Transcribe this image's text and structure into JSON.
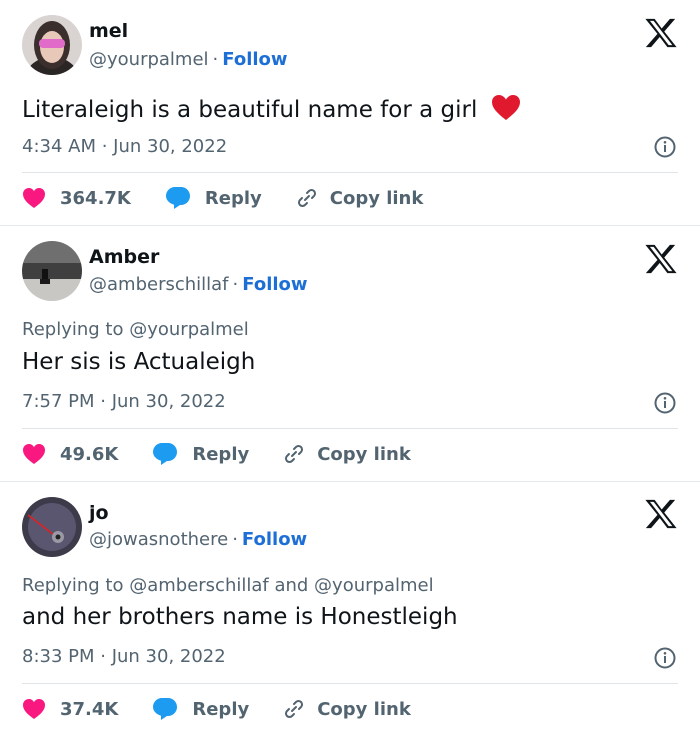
{
  "tweets": [
    {
      "name": "mel",
      "handle": "@yourpalmel",
      "follow": "Follow",
      "replying_prefix": "",
      "replying_to": "",
      "text": "Literaleigh is a beautiful name for a girl",
      "time": "4:34 AM · Jun 30, 2022",
      "likes": "364.7K",
      "reply_label": "Reply",
      "copy_label": "Copy link"
    },
    {
      "name": "Amber",
      "handle": "@amberschillaf",
      "follow": "Follow",
      "replying_prefix": "Replying to",
      "replying_to": "@yourpalmel",
      "text": "Her sis is Actualeigh",
      "time": "7:57 PM · Jun 30, 2022",
      "likes": "49.6K",
      "reply_label": "Reply",
      "copy_label": "Copy link"
    },
    {
      "name": "jo",
      "handle": "@jowasnothere",
      "follow": "Follow",
      "replying_prefix": "Replying to",
      "replying_to": "@amberschillaf and @yourpalmel",
      "text": "and her brothers name is Honestleigh",
      "time": "8:33 PM · Jun 30, 2022",
      "likes": "37.4K",
      "reply_label": "Reply",
      "copy_label": "Copy link"
    }
  ],
  "colors": {
    "heart": "#f91880",
    "reply_bubble": "#1d9bf0",
    "follow": "#1d6fd6",
    "secondary_text": "#536471"
  },
  "icons": [
    "x-logo-icon",
    "info-icon",
    "heart-icon",
    "reply-bubble-icon",
    "link-icon",
    "red-heart-emoji-icon"
  ]
}
